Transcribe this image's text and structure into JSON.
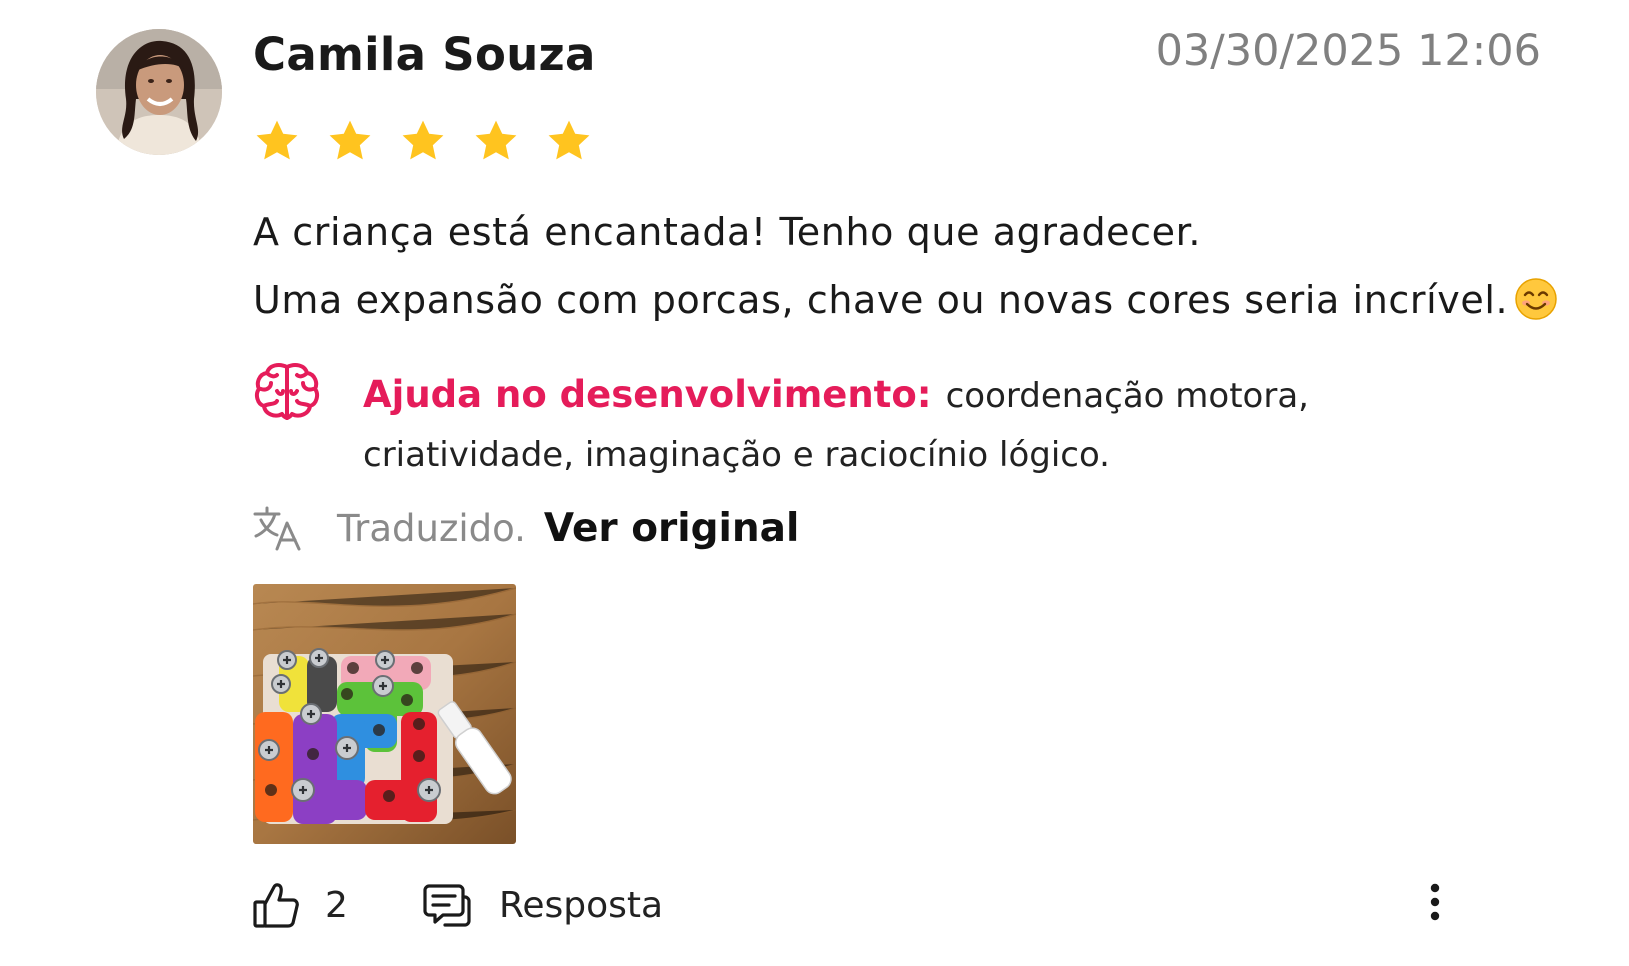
{
  "review": {
    "reviewer_name": "Camila Souza",
    "date": "03/30/2025 12:06",
    "rating": 5,
    "rating_max": 5,
    "star_color": "#FFC41F",
    "text_lines": [
      "A criança está encantada! Tenho que agradecer.",
      "Uma expansão com porcas, chave ou novas cores seria incrível."
    ],
    "emoji": "smiling-face-icon",
    "development": {
      "label": "Ajuda no desenvolvimento:",
      "text": "coordenação motora, criatividade, imaginação e raciocínio lógico.",
      "accent_color": "#E51C5A",
      "icon": "brain-icon"
    },
    "translation": {
      "status": "Traduzido.",
      "link": "Ver original"
    },
    "photo": {
      "icon": "review-photo"
    },
    "actions": {
      "like_count": "2",
      "reply_label": "Resposta",
      "more_icon": "more-vertical-icon"
    }
  }
}
